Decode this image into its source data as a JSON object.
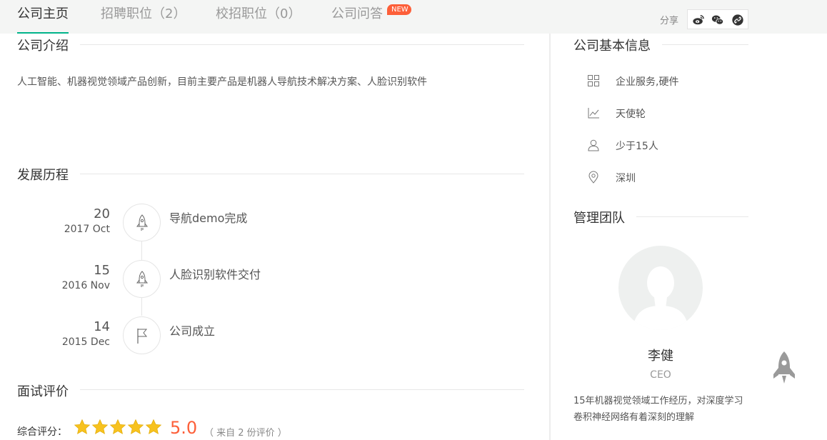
{
  "tabs": [
    {
      "label": "公司主页",
      "active": true
    },
    {
      "label": "招聘职位（2）",
      "active": false
    },
    {
      "label": "校招职位（0）",
      "active": false
    },
    {
      "label": "公司问答",
      "active": false
    }
  ],
  "new_badge": "NEW",
  "share": {
    "label": "分享",
    "icons": [
      "weibo-icon",
      "wechat-icon",
      "link-icon"
    ]
  },
  "intro": {
    "title": "公司介绍",
    "text": "人工智能、机器视觉领域产品创新，目前主要产品是机器人导航技术解决方案、人脸识别软件"
  },
  "history": {
    "title": "发展历程",
    "events": [
      {
        "day": "20",
        "date": "2017 Oct",
        "text": "导航demo完成",
        "icon": "rocket-icon"
      },
      {
        "day": "15",
        "date": "2016 Nov",
        "text": "人脸识别软件交付",
        "icon": "rocket-icon"
      },
      {
        "day": "14",
        "date": "2015 Dec",
        "text": "公司成立",
        "icon": "flag-icon"
      }
    ]
  },
  "reviews": {
    "title": "面试评价",
    "rating_label": "综合评分：",
    "stars": 5,
    "score": "5.0",
    "count_text": "（ 来自 2 份评价 ）"
  },
  "basic_info": {
    "title": "公司基本信息",
    "items": [
      {
        "icon": "grid-icon",
        "text": "企业服务,硬件"
      },
      {
        "icon": "chart-icon",
        "text": "天使轮"
      },
      {
        "icon": "person-icon",
        "text": "少于15人"
      },
      {
        "icon": "location-icon",
        "text": "深圳"
      }
    ]
  },
  "team": {
    "title": "管理团队",
    "member": {
      "name": "李健",
      "title": "CEO",
      "desc": "15年机器视觉领域工作经历，对深度学习卷积神经网络有着深刻的理解"
    }
  },
  "colors": {
    "accent": "#00b38a",
    "badge": "#fd5f39",
    "star": "#f7c21f"
  }
}
